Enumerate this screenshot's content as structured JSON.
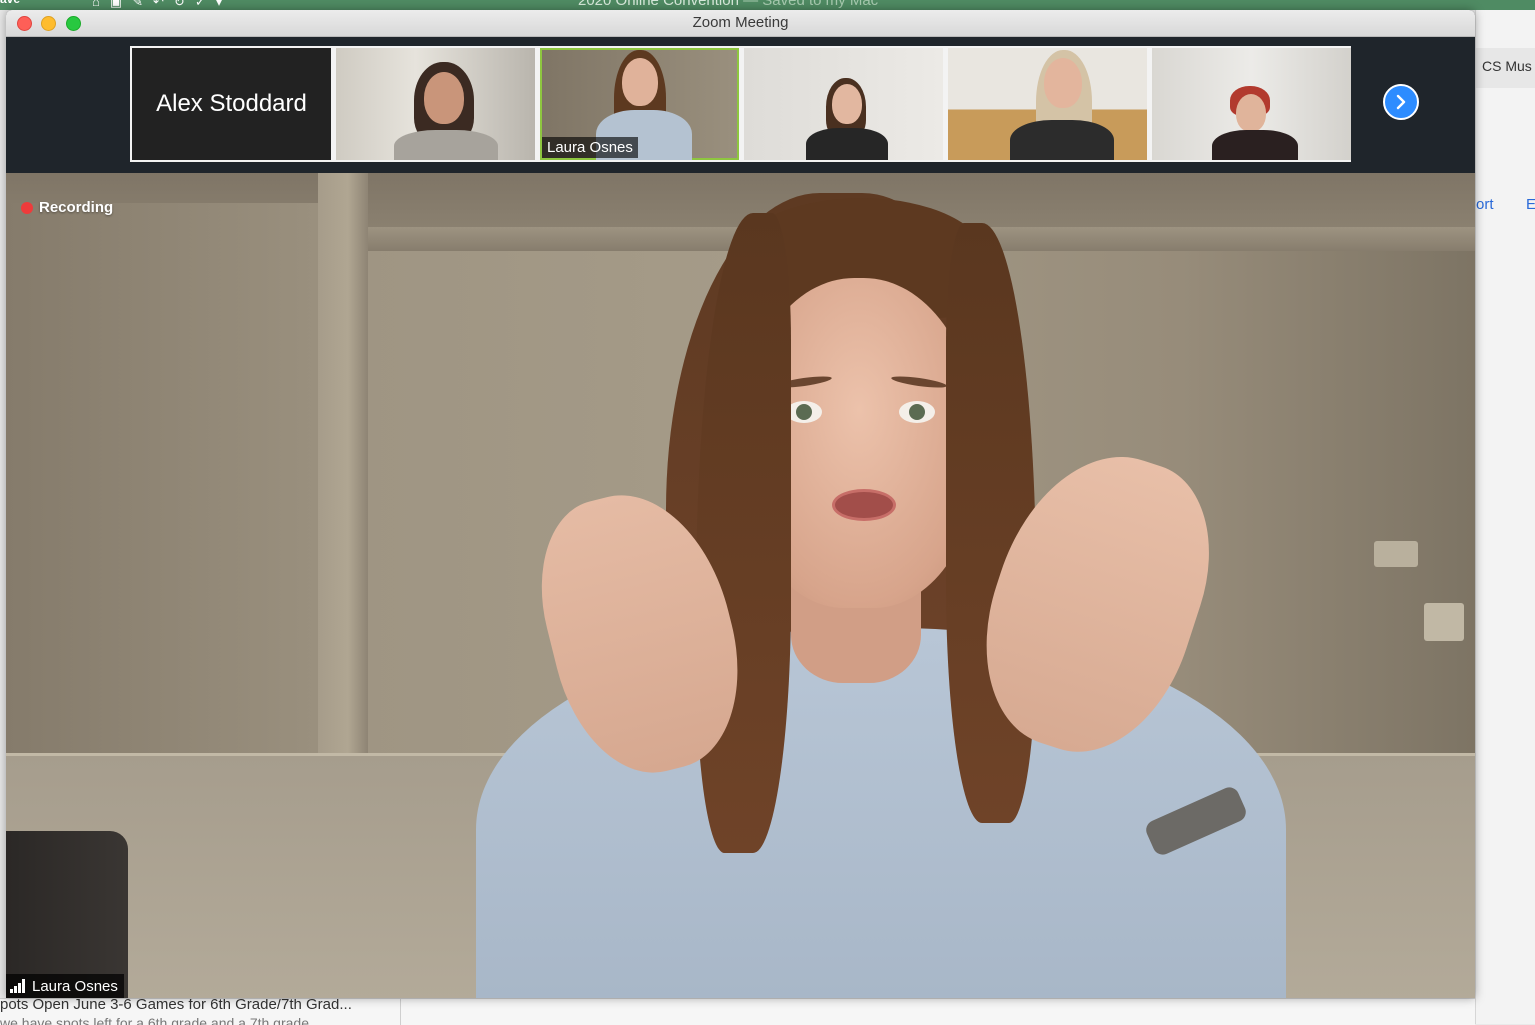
{
  "background": {
    "left_label": "ave",
    "doc_title": "2020 Online Convention",
    "doc_saved": " — Saved to my Mac",
    "right_tab": "CS Mus",
    "right_link_1": "ort",
    "right_link_2": "E",
    "bottom_line_1": "pots Open June 3-6 Games for 6th Grade/7th Grad...",
    "bottom_line_2": "we have spots left for a 6th grade and a 7th grade"
  },
  "window": {
    "title": "Zoom Meeting"
  },
  "strip": {
    "participants": [
      {
        "name": "Alex Stoddard",
        "video": false
      },
      {
        "name": "",
        "video": true
      },
      {
        "name": "Laura Osnes",
        "video": true,
        "active": true
      },
      {
        "name": "",
        "video": true
      },
      {
        "name": "",
        "video": true
      },
      {
        "name": "",
        "video": true
      }
    ],
    "next_icon": "chevron-right-icon"
  },
  "main": {
    "recording_label": "Recording",
    "speaker_name": "Laura Osnes",
    "accent_color": "#2d8cff",
    "recording_color": "#ee3b3b",
    "active_speaker_color": "#8ec63f"
  }
}
